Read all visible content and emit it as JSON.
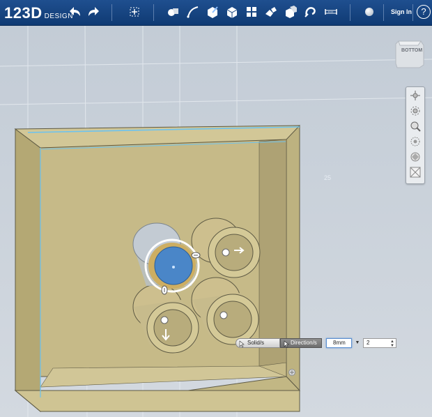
{
  "app": {
    "logo_main": "123D",
    "logo_sub": "DESIGN",
    "signin_label": "Sign In",
    "help_label": "?"
  },
  "toolbar": {
    "icons": [
      "undo-icon",
      "redo-icon",
      "transform-icon",
      "primitives-icon",
      "sketch-icon",
      "construct-icon",
      "modify-icon",
      "pattern-icon",
      "grouping-icon",
      "combine-icon",
      "measure-icon",
      "snap-icon",
      "ruler-icon",
      "material-icon"
    ]
  },
  "viewcube": {
    "face_label": "BOTTOM"
  },
  "viewport": {
    "dimension_label": "25"
  },
  "pattern_bar": {
    "solids_label": "Solid/s",
    "direction_label": "Direction/s",
    "distance_value": "8mm",
    "dropdown_symbol": "▼",
    "count_value": "2"
  },
  "colors": {
    "toolbar_bg": "#14427f",
    "box_face": "#c9bd8c",
    "box_side": "#b4a874",
    "selection_blue": "#4a86c8",
    "edge_highlight": "#6cc3f0"
  }
}
